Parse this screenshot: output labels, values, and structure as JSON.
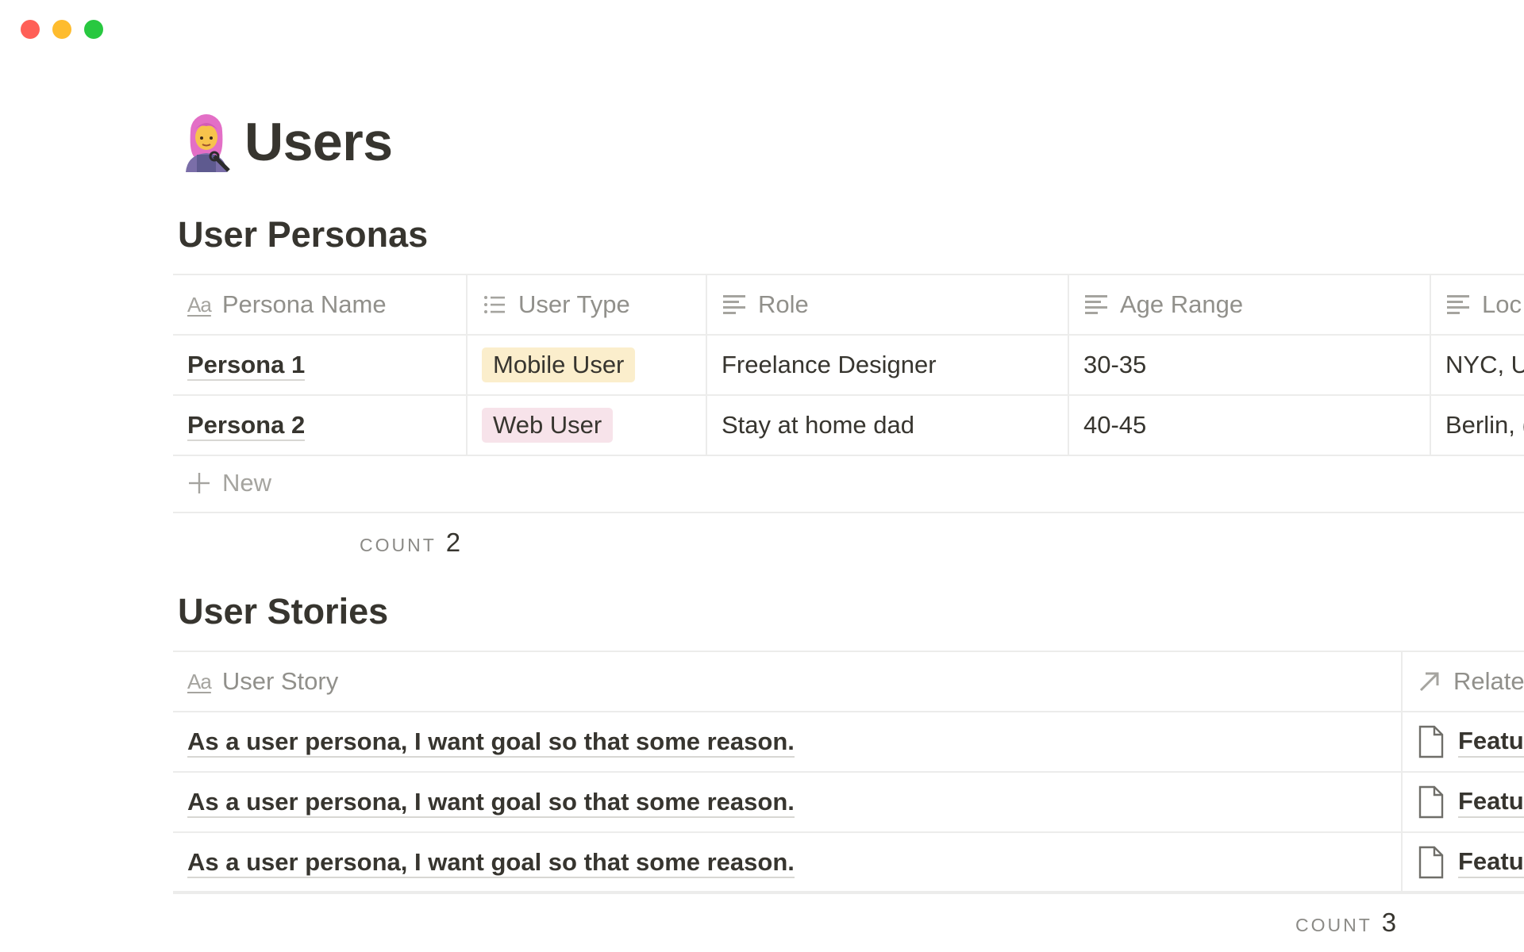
{
  "page": {
    "emoji_name": "woman-mechanic-emoji",
    "title": "Users"
  },
  "personas": {
    "heading": "User Personas",
    "columns": [
      {
        "label": "Persona Name",
        "icon": "title-aa-icon"
      },
      {
        "label": "User Type",
        "icon": "list-icon"
      },
      {
        "label": "Role",
        "icon": "text-lines-icon"
      },
      {
        "label": "Age Range",
        "icon": "text-lines-icon"
      },
      {
        "label": "Loc",
        "icon": "text-lines-icon"
      }
    ],
    "rows": [
      {
        "name": "Persona 1",
        "user_type": "Mobile User",
        "role": "Freelance Designer",
        "age": "30-35",
        "location": "NYC, U"
      },
      {
        "name": "Persona 2",
        "user_type": "Web User",
        "role": "Stay at home dad",
        "age": "40-45",
        "location": "Berlin, ("
      }
    ],
    "new_label": "New",
    "count_label": "COUNT",
    "count_value": "2"
  },
  "stories": {
    "heading": "User Stories",
    "columns": [
      {
        "label": "User Story",
        "icon": "title-aa-icon"
      },
      {
        "label": "Relate",
        "icon": "relation-arrow-icon"
      }
    ],
    "rows": [
      {
        "story": "As a user persona, I want goal so that some reason.",
        "related": "Featu"
      },
      {
        "story": "As a user persona, I want goal so that some reason.",
        "related": "Featu"
      },
      {
        "story": "As a user persona, I want goal so that some reason.",
        "related": "Featu"
      }
    ],
    "count_label": "COUNT",
    "count_value": "3"
  },
  "colors": {
    "mobile_tag_bg": "#fbeecc",
    "web_tag_bg": "#f7e3ea",
    "traffic_red": "#ff5f57",
    "traffic_yellow": "#febc2e",
    "traffic_green": "#28c840"
  }
}
